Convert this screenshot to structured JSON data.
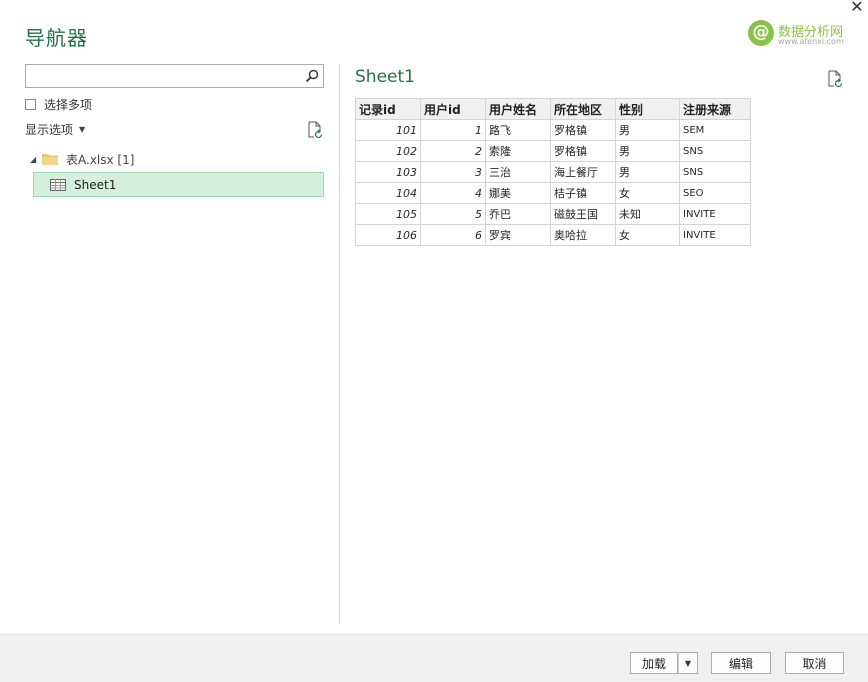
{
  "window": {
    "title": "导航器",
    "close_glyph": "✕"
  },
  "watermark": {
    "logo_glyph": "@",
    "text": "数据分析网",
    "url": "www.afenxi.com"
  },
  "left_panel": {
    "search": {
      "value": "",
      "placeholder": ""
    },
    "multi_select_label": "选择多项",
    "display_options_label": "显示选项",
    "tree": {
      "folder_label": "表A.xlsx [1]",
      "sheet_label": "Sheet1"
    }
  },
  "preview": {
    "title": "Sheet1",
    "columns": [
      "记录id",
      "用户id",
      "用户姓名",
      "所在地区",
      "性别",
      "注册来源"
    ],
    "rows": [
      [
        "101",
        "1",
        "路飞",
        "罗格镇",
        "男",
        "SEM"
      ],
      [
        "102",
        "2",
        "索隆",
        "罗格镇",
        "男",
        "SNS"
      ],
      [
        "103",
        "3",
        "三治",
        "海上餐厅",
        "男",
        "SNS"
      ],
      [
        "104",
        "4",
        "娜美",
        "桔子镇",
        "女",
        "SEO"
      ],
      [
        "105",
        "5",
        "乔巴",
        "磁鼓王国",
        "未知",
        "INVITE"
      ],
      [
        "106",
        "6",
        "罗宾",
        "奥哈拉",
        "女",
        "INVITE"
      ]
    ]
  },
  "footer": {
    "load_label": "加载",
    "edit_label": "编辑",
    "cancel_label": "取消"
  },
  "colors": {
    "accent": "#217346",
    "selection_bg": "#d4efdd",
    "watermark": "#8bc34a"
  }
}
